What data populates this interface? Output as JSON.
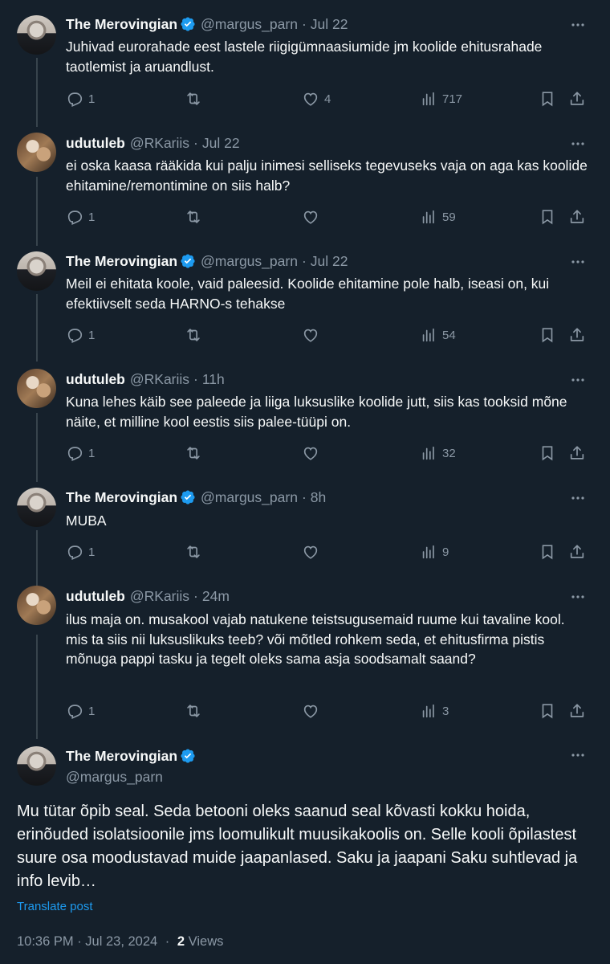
{
  "tweets": [
    {
      "name": "The Merovingian",
      "verified": true,
      "handle": "@margus_parn",
      "time": "Jul 22",
      "avatar": "merovingian",
      "text": "Juhivad eurorahade eest lastele riigigümnaasiumide jm koolide ehitusrahade taotlemist ja aruandlust.",
      "replies": "1",
      "reposts": "",
      "likes": "4",
      "views": "717"
    },
    {
      "name": "udutuleb",
      "verified": false,
      "handle": "@RKariis",
      "time": "Jul 22",
      "avatar": "udutuleb",
      "text": "ei oska kaasa rääkida kui palju inimesi selliseks tegevuseks vaja on aga kas koolide ehitamine/remontimine on siis halb?",
      "replies": "1",
      "reposts": "",
      "likes": "",
      "views": "59"
    },
    {
      "name": "The Merovingian",
      "verified": true,
      "handle": "@margus_parn",
      "time": "Jul 22",
      "avatar": "merovingian",
      "text": "Meil ei ehitata koole, vaid paleesid. Koolide ehitamine pole halb, iseasi on, kui efektiivselt seda HARNO-s tehakse",
      "replies": "1",
      "reposts": "",
      "likes": "",
      "views": "54"
    },
    {
      "name": "udutuleb",
      "verified": false,
      "handle": "@RKariis",
      "time": "11h",
      "avatar": "udutuleb",
      "text": "Kuna lehes käib see paleede ja liiga luksuslike koolide jutt, siis kas tooksid mõne näite, et milline kool eestis siis palee-tüüpi on.",
      "replies": "1",
      "reposts": "",
      "likes": "",
      "views": "32"
    },
    {
      "name": "The Merovingian",
      "verified": true,
      "handle": "@margus_parn",
      "time": "8h",
      "avatar": "merovingian",
      "text": "MUBA",
      "replies": "1",
      "reposts": "",
      "likes": "",
      "views": "9"
    },
    {
      "name": "udutuleb",
      "verified": false,
      "handle": "@RKariis",
      "time": "24m",
      "avatar": "udutuleb",
      "text": "ilus maja on. musakool vajab natukene teistsugusemaid ruume kui tavaline kool. mis ta siis nii luksuslikuks teeb? või mõtled rohkem seda, et ehitusfirma pistis mõnuga pappi tasku ja tegelt oleks sama asja soodsamalt saand?",
      "replies": "1",
      "reposts": "",
      "likes": "",
      "views": "3"
    }
  ],
  "main": {
    "name": "The Merovingian",
    "verified": true,
    "handle": "@margus_parn",
    "text": "Mu tütar õpib seal. Seda betooni oleks saanud seal kõvasti kokku hoida, erinõuded isolatsioonile jms loomulikult muusikakoolis on. Selle kooli õpilastest suure osa moodustavad muide jaapanlased. Saku ja jaapani Saku suhtlevad ja info levib…",
    "translate_label": "Translate post",
    "timestamp": "10:36 PM · Jul 23, 2024",
    "separator": "·",
    "views_count": "2",
    "views_label": "Views"
  },
  "icons": {
    "more": "more-icon",
    "reply": "reply-icon",
    "repost": "repost-icon",
    "like": "like-icon",
    "views": "views-icon",
    "bookmark": "bookmark-icon",
    "share": "share-icon",
    "verified": "verified-badge-icon"
  },
  "colors": {
    "background": "#15202b",
    "text": "#f7f9f9",
    "secondary": "#8b98a5",
    "accent": "#1d9bf0",
    "translate": "#1d9bf0",
    "thread_line": "#38444d"
  }
}
